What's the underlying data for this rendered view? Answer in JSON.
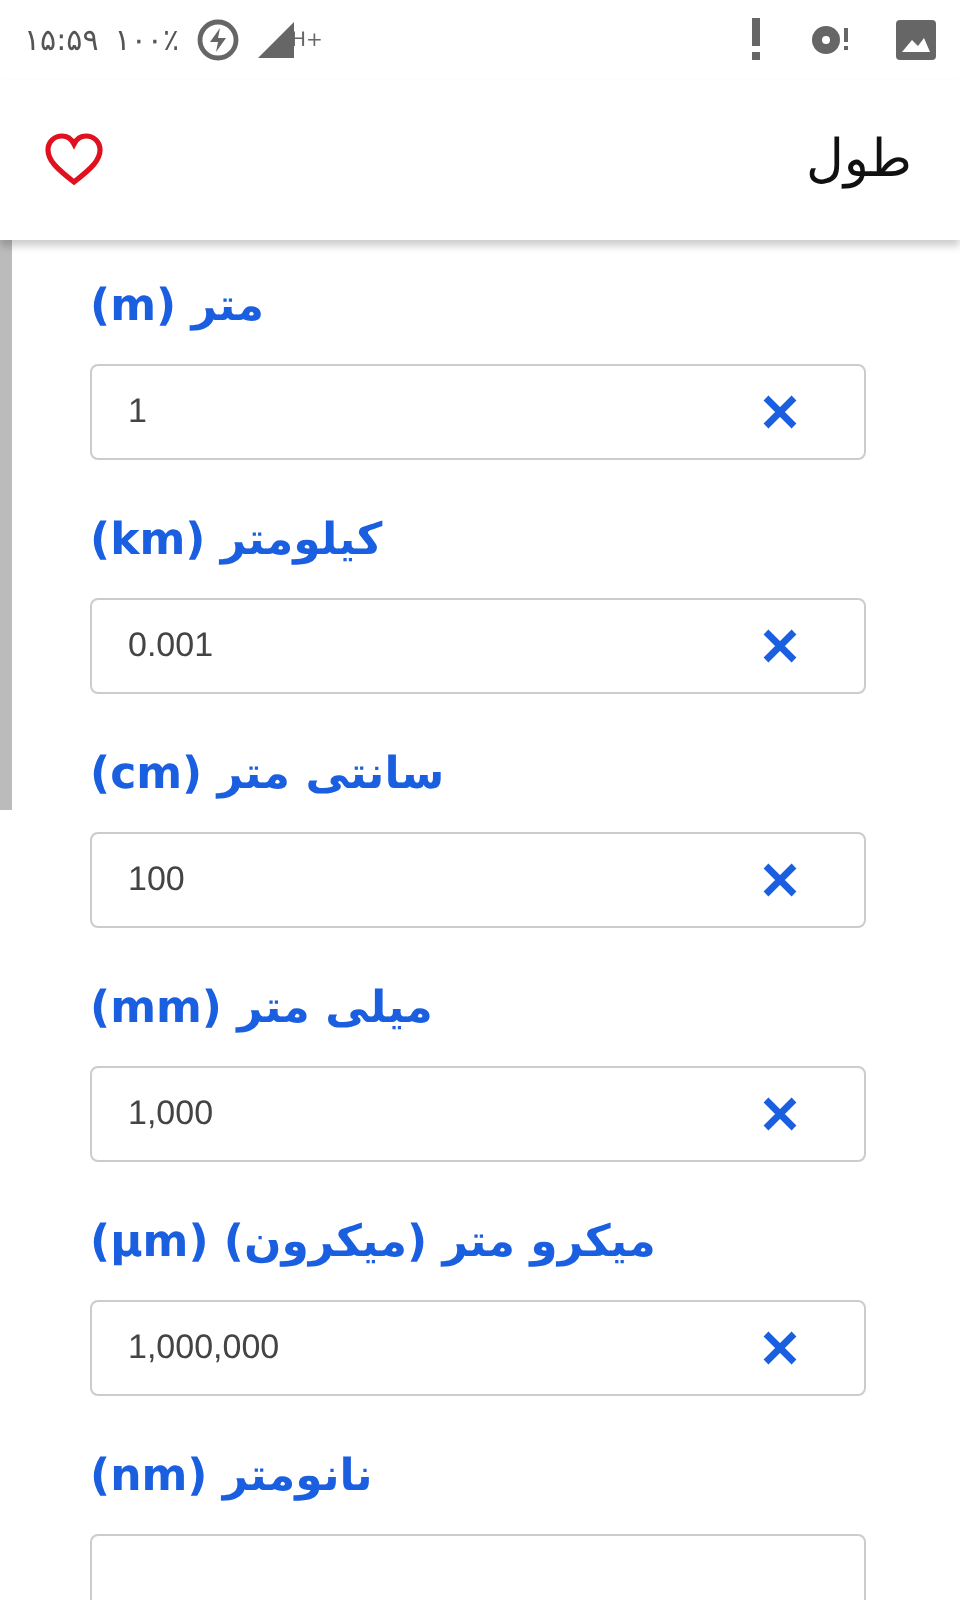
{
  "status_bar": {
    "time": "۱۵:۵۹",
    "battery": "۱۰۰٪",
    "network": "H+"
  },
  "toolbar": {
    "title": "طول",
    "favorite": false
  },
  "units": [
    {
      "label": "متر (m)",
      "value": "1"
    },
    {
      "label": "کیلومتر (km)",
      "value": "0.001"
    },
    {
      "label": "سانتی متر (cm)",
      "value": "100"
    },
    {
      "label": "میلی متر (mm)",
      "value": "1,000"
    },
    {
      "label": "میکرو متر (میکرون) (µm)",
      "value": "1,000,000"
    },
    {
      "label": "نانومتر (nm)"
    }
  ]
}
